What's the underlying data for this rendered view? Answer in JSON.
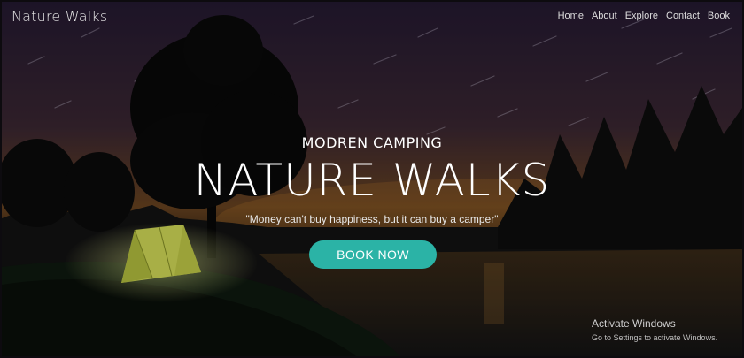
{
  "brand": "Nature Walks",
  "nav": {
    "items": [
      "Home",
      "About",
      "Explore",
      "Contact",
      "Book"
    ]
  },
  "hero": {
    "subtitle": "MODREN CAMPING",
    "title": "NATURE WALKS",
    "quote": "\"Money can't buy happiness, but it can buy a camper\"",
    "cta_label": "BOOK NOW"
  },
  "watermark": {
    "title": "Activate Windows",
    "subtitle": "Go to Settings to activate Windows."
  },
  "colors": {
    "accent": "#2bb3a6",
    "text": "#ffffff"
  }
}
